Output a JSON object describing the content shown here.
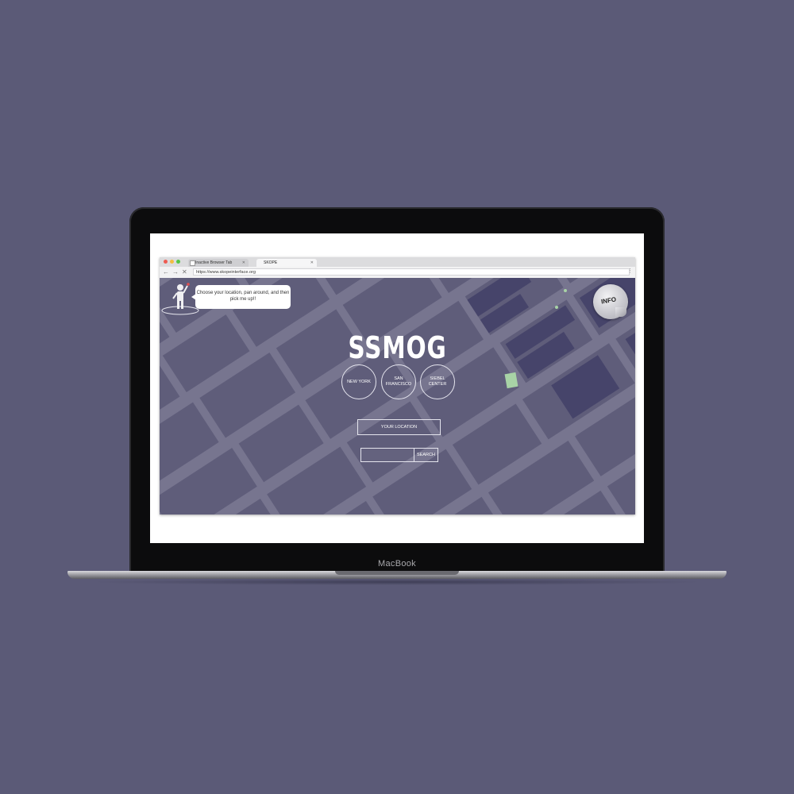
{
  "device": {
    "brand_label": "MacBook"
  },
  "browser": {
    "tabs": [
      {
        "label": "Inactive Browser Tab",
        "active": false
      },
      {
        "label": "SKOPE",
        "active": true
      }
    ],
    "url": "https://www.skopeinterface.org"
  },
  "app": {
    "title": "SSMOG",
    "mascot_message": "Choose your location, pan around, and then pick me up!!",
    "cities": [
      "NEW YORK",
      "SAN\nFRANCISCO",
      "SIEBEL\nCENTER"
    ],
    "location_button": "YOUR LOCATION",
    "search_placeholder": "",
    "search_button": "SEARCH",
    "info_button": "INFO"
  },
  "icons": {
    "mascot": "person-waving-icon",
    "close": "close-icon",
    "back": "arrow-left-icon",
    "forward": "arrow-right-icon",
    "stop": "close-icon",
    "menu": "vertical-dots-icon"
  },
  "colors": {
    "background": "#5b5a77",
    "map_base": "#77758f",
    "map_blocks": "#5f5d7a",
    "map_dark_blocks": "#46446a",
    "park": "#a8d3a6"
  }
}
